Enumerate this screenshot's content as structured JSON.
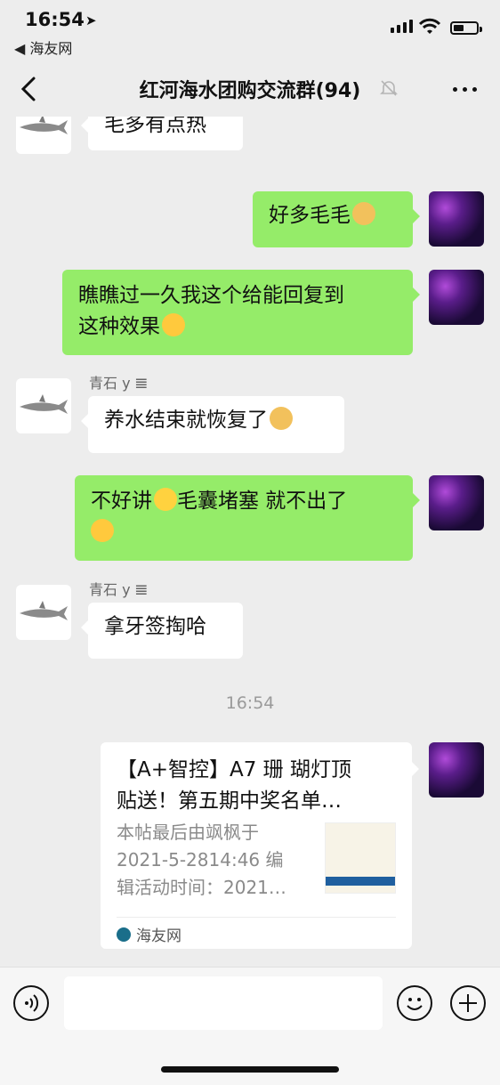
{
  "status_bar": {
    "time": "16:54",
    "back_app": "◀ 海友网"
  },
  "navbar": {
    "title": "红河海水团购交流群(94)"
  },
  "messages": [
    {
      "side": "left",
      "text": "毛多有点热"
    },
    {
      "side": "right",
      "text": "好多毛毛",
      "emoji": "doge-emoji"
    },
    {
      "side": "right",
      "line1": "瞧瞧过一久我这个给能回复到",
      "line2": "这种效果",
      "emoji": "facepalm-emoji"
    },
    {
      "side": "left",
      "sender": "青石 y 𝌆",
      "text": "养水结束就恢复了",
      "emoji": "doge-emoji"
    },
    {
      "side": "right",
      "line1": "不好讲",
      "line1b": "毛囊堵塞 就不出了",
      "emoji": "laughing-emoji"
    },
    {
      "side": "left",
      "sender": "青石 y 𝌆",
      "text": "拿牙签掏哈"
    }
  ],
  "timestamp": "16:54",
  "link_card": {
    "title_line1": "【A+智控】A7 珊 瑚灯顶",
    "title_line2": "贴送！第五期中奖名单…",
    "desc_line1": "本帖最后由飒枫于",
    "desc_line2": "2021-5-2814:46 编",
    "desc_line3": "辑活动时间：2021…",
    "source": "海友网"
  },
  "colors": {
    "bubble_green": "#95ec69",
    "chat_bg": "#ededed"
  }
}
